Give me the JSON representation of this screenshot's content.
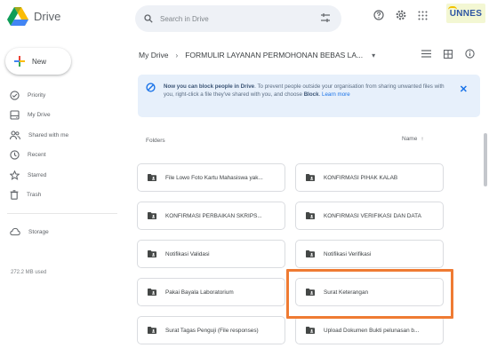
{
  "app": {
    "title": "Drive"
  },
  "search": {
    "placeholder": "Search in Drive"
  },
  "brand": {
    "text": "UNNES"
  },
  "sidebar": {
    "new_label": "New",
    "items": [
      {
        "label": "Priority",
        "icon": "check-circle-icon"
      },
      {
        "label": "My Drive",
        "icon": "drive-icon"
      },
      {
        "label": "Shared with me",
        "icon": "people-icon"
      },
      {
        "label": "Recent",
        "icon": "clock-icon"
      },
      {
        "label": "Starred",
        "icon": "star-icon"
      },
      {
        "label": "Trash",
        "icon": "trash-icon"
      }
    ],
    "storage": {
      "label": "Storage",
      "usage": "272.2 MB used"
    }
  },
  "breadcrumb": {
    "root": "My Drive",
    "current": "FORMULIR LAYANAN PERMOHONAN BEBAS LA..."
  },
  "banner": {
    "title": "Now you can block people in Drive",
    "text": "To prevent people outside your organisation from sharing unwanted files with you, right-click a file they've shared with you, and choose",
    "strong": "Block",
    "link": "Learn more"
  },
  "folders_label": "Folders",
  "sort_label": "Name",
  "folders": [
    {
      "name": "File Lowo Foto Kartu Mahasiswa yak..."
    },
    {
      "name": "KONFIRMASI PIHAK KALAB"
    },
    {
      "name": "KONFIRMASI PERBAIKAN SKRIPS..."
    },
    {
      "name": "KONFIRMASI VERIFIKASI DAN DATA"
    },
    {
      "name": "Notifikasi Validasi"
    },
    {
      "name": "Notifikasi Verifikasi"
    },
    {
      "name": "Pakai Bayala Laboratorium"
    },
    {
      "name": "Surat Keterangan"
    },
    {
      "name": "Surat Tagas Penguji (File responses)"
    },
    {
      "name": "Upload Dokumen Bukti pelunasan b..."
    }
  ],
  "colors": {
    "accent": "#1a73e8",
    "banner_bg": "#e7f0fb",
    "highlight": "#ef7b33",
    "folder_icon": "#444746"
  }
}
